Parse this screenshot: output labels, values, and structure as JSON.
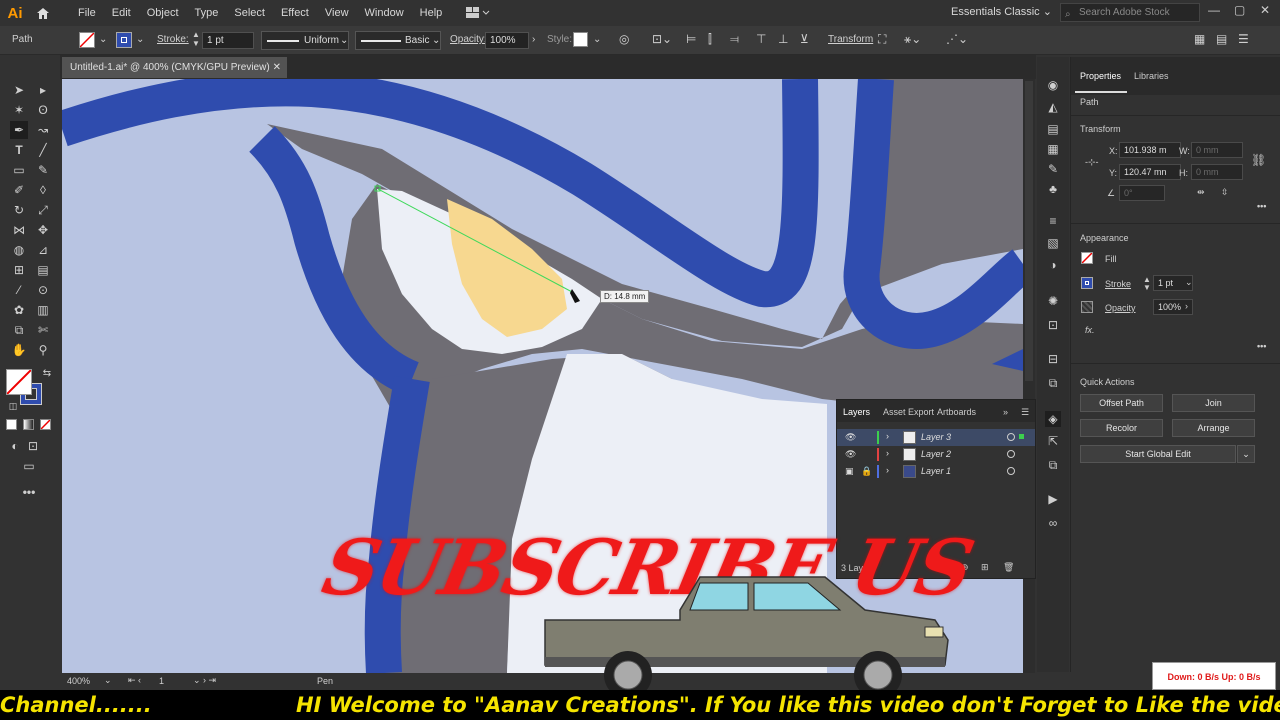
{
  "app": {
    "logo": "Ai"
  },
  "menu": [
    "File",
    "Edit",
    "Object",
    "Type",
    "Select",
    "Effect",
    "View",
    "Window",
    "Help"
  ],
  "workspace": "Essentials Classic",
  "search_placeholder": "Search Adobe Stock",
  "control_bar": {
    "object_type": "Path",
    "stroke_label": "Stroke:",
    "stroke_weight": "1 pt",
    "profile": "Uniform",
    "brush": "Basic",
    "opacity_label": "Opacity:",
    "opacity_value": "100%",
    "style_label": "Style:",
    "transform_label": "Transform"
  },
  "document_tab": "Untitled-1.ai* @ 400% (CMYK/GPU Preview)",
  "canvas": {
    "distance_tip": "D: 14.8 mm"
  },
  "status_bar": {
    "zoom": "400%",
    "artboard": "1",
    "tool": "Pen"
  },
  "properties": {
    "tabs": [
      "Properties",
      "Libraries"
    ],
    "object_type": "Path",
    "transform_title": "Transform",
    "x_label": "X:",
    "x_value": "101.938 m",
    "y_label": "Y:",
    "y_value": "120.47 mn",
    "w_label": "W:",
    "w_value": "0 mm",
    "h_label": "H:",
    "h_value": "0 mm",
    "angle_value": "0°",
    "appearance_title": "Appearance",
    "fill_label": "Fill",
    "stroke_label": "Stroke",
    "stroke_value": "1 pt",
    "opacity_label": "Opacity",
    "opacity_value": "100%",
    "fx_label": "fx.",
    "quick_actions_title": "Quick Actions",
    "buttons": {
      "offset_path": "Offset Path",
      "join": "Join",
      "recolor": "Recolor",
      "arrange": "Arrange",
      "global_edit": "Start Global Edit"
    }
  },
  "layers": {
    "tabs": [
      "Layers",
      "Asset Export",
      "Artboards"
    ],
    "rows": [
      {
        "name": "Layer 3",
        "color": "#3ccf4e"
      },
      {
        "name": "Layer 2",
        "color": "#e34242"
      },
      {
        "name": "Layer 1",
        "color": "#4f6fe0"
      }
    ],
    "footer": "3 Layers"
  },
  "overlay": {
    "subscribe": "SUBSCRIBE US",
    "net_speed": "Down: 0 B/s   Up: 0 B/s",
    "ticker_left": "Channel.......",
    "ticker_main": "HI Welcome to \"Aanav Creations\". If You like this video don't Forget to Like the video, S"
  },
  "colors": {
    "blue_outline": "#2f4cae",
    "canvas_bg": "#b8c4e2",
    "gray_band": "#6f6d74",
    "highlight": "#f7d890",
    "ticker_text": "#f5e400",
    "subscribe_red": "#ef1a1a"
  }
}
